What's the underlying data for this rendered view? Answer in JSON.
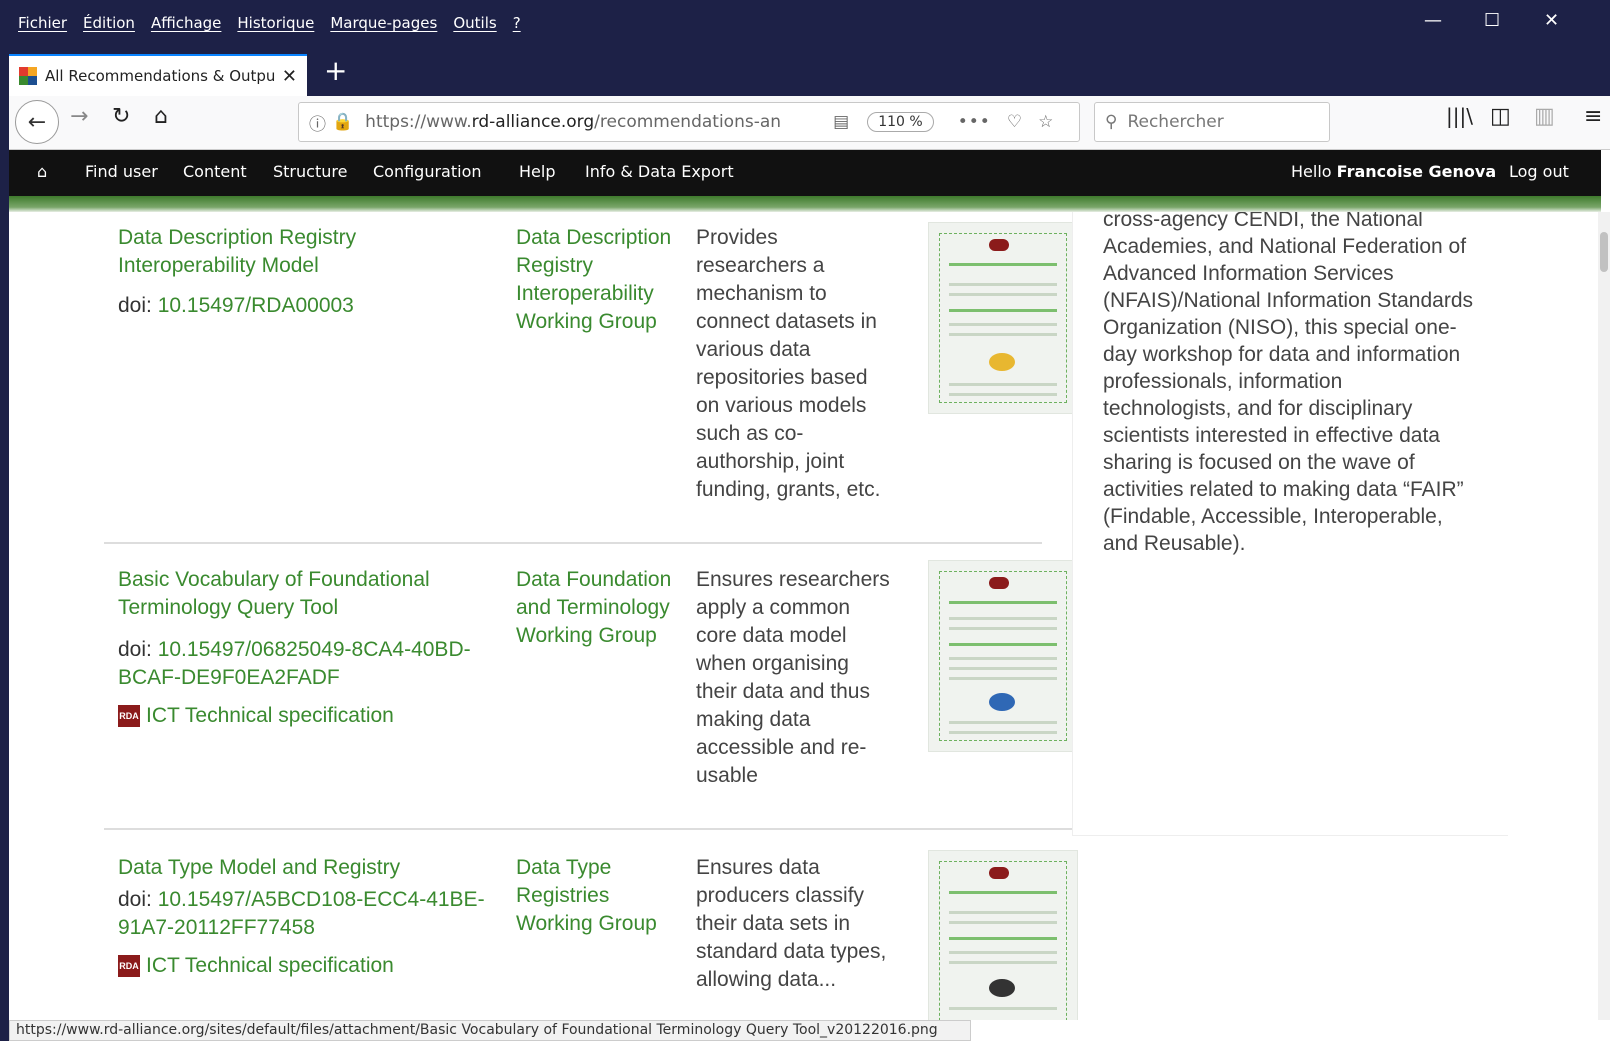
{
  "menu": [
    "Fichier",
    "Édition",
    "Affichage",
    "Historique",
    "Marque-pages",
    "Outils",
    "?"
  ],
  "tab": {
    "title": "All Recommendations & Outpu"
  },
  "url": {
    "prefix": "https://www.",
    "domain": "rd-alliance.org",
    "path": "/recommendations-an",
    "zoom": "110 %"
  },
  "search": {
    "placeholder": "Rechercher"
  },
  "admin": {
    "items": [
      "Find user",
      "Content",
      "Structure",
      "Configuration",
      "Help",
      "Info & Data Export"
    ],
    "greeting": "Hello",
    "user": "Francoise Genova",
    "logout": "Log out"
  },
  "rows": [
    {
      "title": "Data Description Registry Interoperability Model",
      "doi_label": "doi:",
      "doi": "10.15497/RDA00003",
      "wg": "Data Description Registry Interoperability Working Group",
      "desc": "Provides researchers a mechanism to connect datasets in various data repositories based on various models such as co-authorship, joint funding, grants, etc."
    },
    {
      "title": "Basic Vocabulary of Foundational Terminology Query Tool",
      "doi_label": "doi:",
      "doi": "10.15497/06825049-8CA4-40BD-BCAF-DE9F0EA2FADF",
      "ict": "ICT Technical specification",
      "wg": "Data Foundation and Terminology Working Group",
      "desc": "Ensures researchers apply a common core data model when organising their data and thus making data accessible and re-usable"
    },
    {
      "title": "Data Type Model and Registry",
      "doi_label": "doi:",
      "doi": "10.15497/A5BCD108-ECC4-41BE-91A7-20112FF77458",
      "ict": "ICT Technical specification",
      "wg": "Data Type Registries Working Group",
      "desc": "Ensures data producers classify their data sets in standard data types, allowing data..."
    }
  ],
  "sidebar_text": "cross-agency CENDI, the National Academies, and National Federation of Advanced Information Services (NFAIS)/National Information Standards Organization (NISO), this special one-day workshop for data and information professionals, information technologists, and for disciplinary scientists interested in effective data sharing is focused on the wave of activities related to making data “FAIR” (Findable, Accessible, Interoperable, and Reusable).",
  "status_url": "https://www.rd-alliance.org/sites/default/files/attachment/Basic Vocabulary of Foundational Terminology Query Tool_v20122016.png",
  "icons": [
    "back-icon",
    "forward-icon",
    "reload-icon",
    "home-icon",
    "info-icon",
    "lock-icon",
    "reader-icon",
    "more-icon",
    "pocket-icon",
    "star-icon",
    "search-icon",
    "library-icon",
    "sidebar-icon",
    "menu-icon"
  ],
  "colors": {
    "accent": "#3a8a2f",
    "chrome": "#1d2147",
    "admin_bar": "#111111"
  }
}
